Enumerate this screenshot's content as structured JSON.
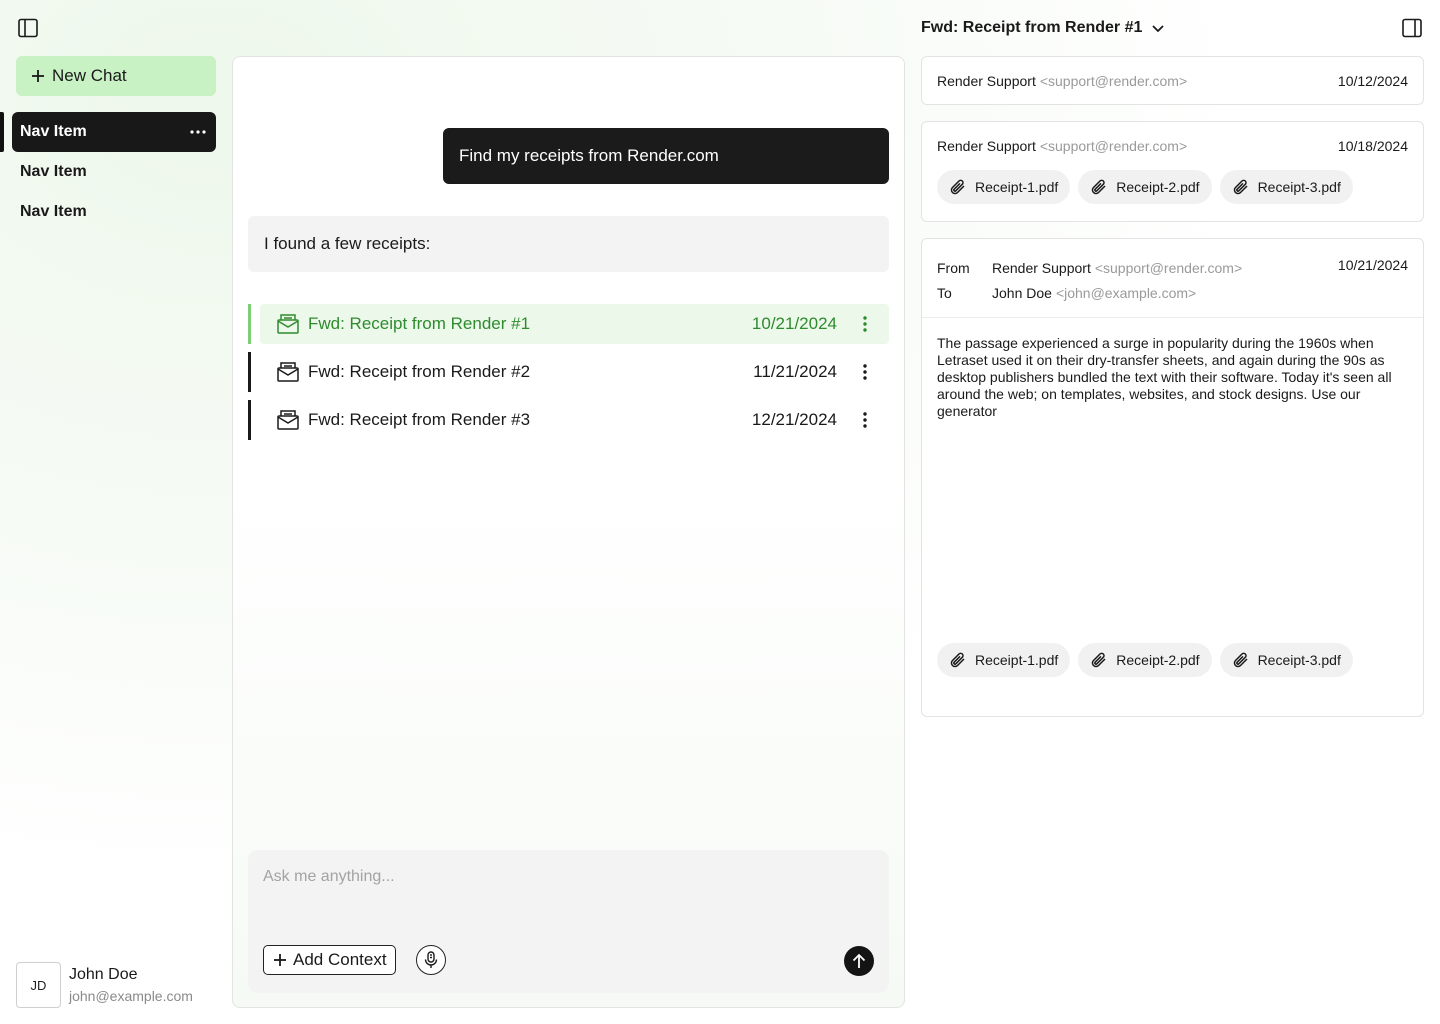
{
  "sidebar": {
    "new_chat_label": "New Chat",
    "items": [
      {
        "label": "Nav Item"
      },
      {
        "label": "Nav Item"
      },
      {
        "label": "Nav Item"
      }
    ],
    "user": {
      "initials": "JD",
      "name": "John Doe",
      "email": "john@example.com"
    }
  },
  "chat": {
    "user_message": "Find my receipts from Render.com",
    "bot_message": "I found a few receipts:",
    "receipts": [
      {
        "title": "Fwd: Receipt from Render #1",
        "date": "10/21/2024"
      },
      {
        "title": "Fwd: Receipt from Render #2",
        "date": "11/21/2024"
      },
      {
        "title": "Fwd: Receipt from Render #3",
        "date": "12/21/2024"
      }
    ],
    "composer": {
      "placeholder": "Ask me anything...",
      "add_context_label": "Add Context"
    }
  },
  "email_panel": {
    "title": "Fwd: Receipt from Render #1",
    "messages": [
      {
        "sender": "Render Support",
        "sender_email": "<support@render.com>",
        "date": "10/12/2024"
      },
      {
        "sender": "Render Support",
        "sender_email": "<support@render.com>",
        "date": "10/18/2024",
        "attachments": [
          "Receipt-1.pdf",
          "Receipt-2.pdf",
          "Receipt-3.pdf"
        ]
      },
      {
        "from_label": "From",
        "to_label": "To",
        "sender": "Render Support",
        "sender_email": "<support@render.com>",
        "recipient": "John Doe",
        "recipient_email": "<john@example.com>",
        "date": "10/21/2024",
        "body": "The passage experienced a surge in popularity during the 1960s when Letraset used it on their dry-transfer sheets, and again during the 90s as desktop publishers bundled the text with their software. Today it's seen all around the web; on templates, websites, and stock designs. Use  our generator",
        "attachments": [
          "Receipt-1.pdf",
          "Receipt-2.pdf",
          "Receipt-3.pdf"
        ]
      }
    ]
  },
  "colors": {
    "accent_green": "#2e8b2e",
    "new_chat_bg": "#c8f1c4",
    "selected_row_bg": "#ecf8ea",
    "dark": "#1b1b1b"
  }
}
